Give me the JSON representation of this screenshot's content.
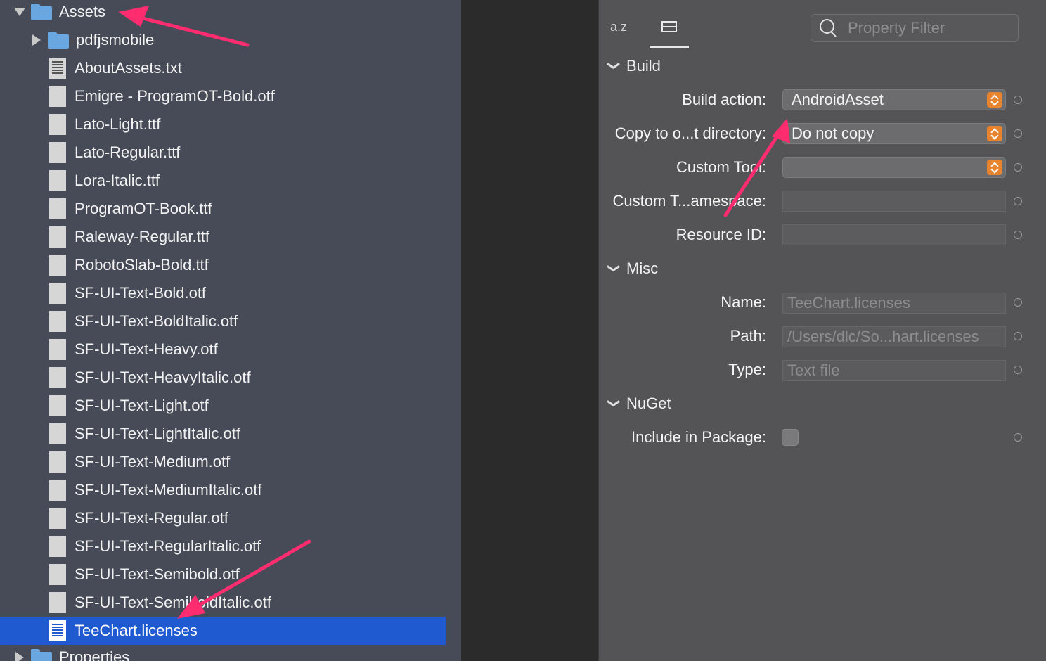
{
  "tree": {
    "root_folder": "Assets",
    "subfolder": "pdfjsmobile",
    "files": [
      "AboutAssets.txt",
      "Emigre - ProgramOT-Bold.otf",
      "Lato-Light.ttf",
      "Lato-Regular.ttf",
      "Lora-Italic.ttf",
      "ProgramOT-Book.ttf",
      "Raleway-Regular.ttf",
      "RobotoSlab-Bold.ttf",
      "SF-UI-Text-Bold.otf",
      "SF-UI-Text-BoldItalic.otf",
      "SF-UI-Text-Heavy.otf",
      "SF-UI-Text-HeavyItalic.otf",
      "SF-UI-Text-Light.otf",
      "SF-UI-Text-LightItalic.otf",
      "SF-UI-Text-Medium.otf",
      "SF-UI-Text-MediumItalic.otf",
      "SF-UI-Text-Regular.otf",
      "SF-UI-Text-RegularItalic.otf",
      "SF-UI-Text-Semibold.otf",
      "SF-UI-Text-SemiboldItalic.otf"
    ],
    "selected_file": "TeeChart.licenses",
    "next_folder": "Properties",
    "selection_color": "#1f5ad1"
  },
  "properties": {
    "sort_az_label": "a.z",
    "search_placeholder": "Property Filter",
    "build": {
      "header": "Build",
      "build_action_label": "Build action:",
      "build_action_value": "AndroidAsset",
      "copy_label": "Copy to o...t directory:",
      "copy_value": "Do not copy",
      "custom_tool_label": "Custom Tool:",
      "custom_tool_value": "",
      "custom_ns_label": "Custom T...amespace:",
      "custom_ns_value": "",
      "resource_id_label": "Resource ID:",
      "resource_id_value": ""
    },
    "misc": {
      "header": "Misc",
      "name_label": "Name:",
      "name_value": "TeeChart.licenses",
      "path_label": "Path:",
      "path_value": "/Users/dlc/So...hart.licenses",
      "type_label": "Type:",
      "type_value": "Text file"
    },
    "nuget": {
      "header": "NuGet",
      "include_label": "Include in Package:",
      "include_checked": false
    },
    "accent_color": "#e8832e"
  },
  "annotation_color": "#ff2d6f"
}
